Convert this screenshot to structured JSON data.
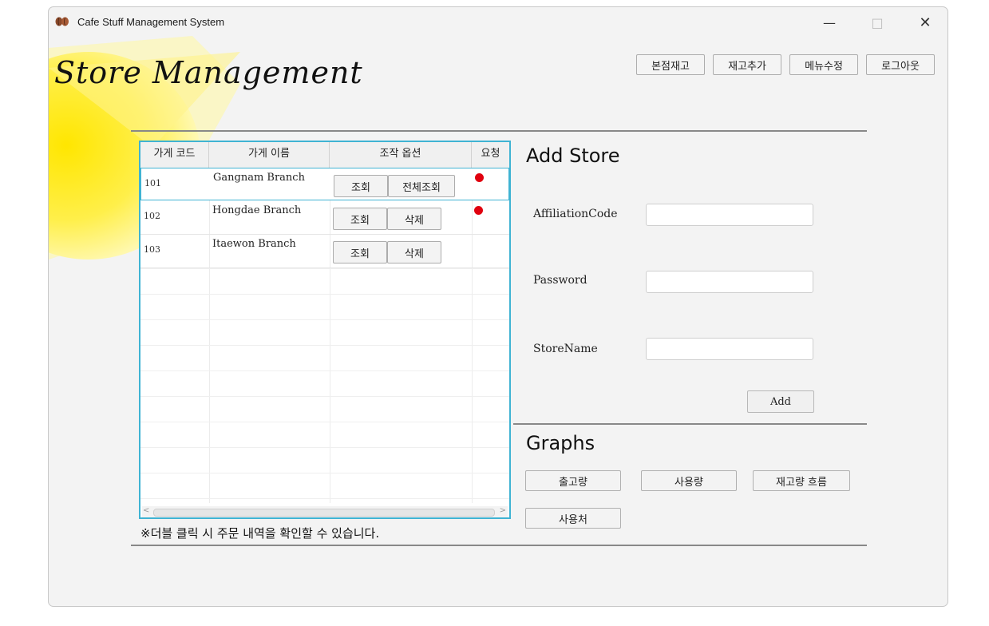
{
  "window": {
    "title": "Cafe Stuff Management System",
    "controls": {
      "minimize": "—",
      "maximize": "□",
      "close": "✕"
    }
  },
  "header": {
    "title": "Store Management"
  },
  "toolbar": [
    "본점재고",
    "재고추가",
    "메뉴수정",
    "로그아웃"
  ],
  "store_table": {
    "columns": [
      "가게 코드",
      "가게 이름",
      "조작 옵션",
      "요청"
    ],
    "rows": [
      {
        "code": "101",
        "name": "Gangnam Branch",
        "btn1": "조회",
        "btn2": "전체조회",
        "request": true,
        "selected": true
      },
      {
        "code": "102",
        "name": "Hongdae Branch",
        "btn1": "조회",
        "btn2": "삭제",
        "request": true,
        "selected": false
      },
      {
        "code": "103",
        "name": "Itaewon Branch",
        "btn1": "조회",
        "btn2": "삭제",
        "request": false,
        "selected": false
      }
    ],
    "scroll": {
      "left": "<",
      "right": ">"
    },
    "note": "※더블 클릭 시 주문 내역을 확인할 수 있습니다."
  },
  "add_store": {
    "title": "Add Store",
    "fields": [
      {
        "label": "AffiliationCode",
        "value": ""
      },
      {
        "label": "Password",
        "value": ""
      },
      {
        "label": "StoreName",
        "value": ""
      }
    ],
    "submit": "Add"
  },
  "graphs": {
    "title": "Graphs",
    "buttons": [
      "출고량",
      "사용량",
      "재고량 흐름",
      "사용처"
    ]
  },
  "colors": {
    "accent_border": "#3fb3d3",
    "request_dot": "#e0000f",
    "sun_yellow": "#ffe600"
  }
}
